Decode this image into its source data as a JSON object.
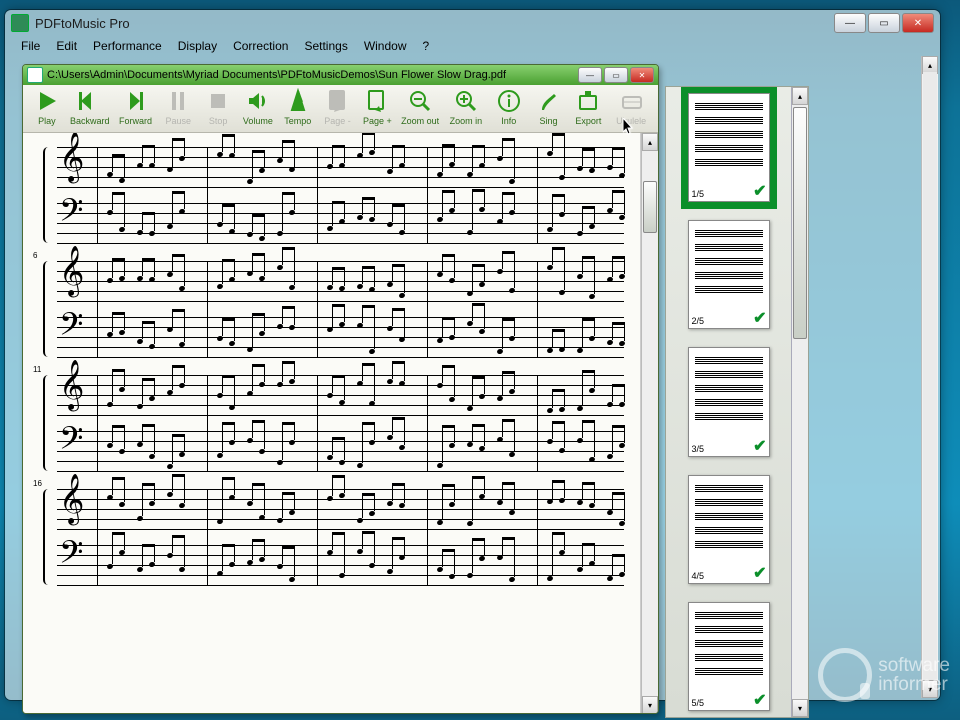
{
  "app": {
    "title": "PDFtoMusic Pro"
  },
  "menubar": [
    "File",
    "Edit",
    "Performance",
    "Display",
    "Correction",
    "Settings",
    "Window",
    "?"
  ],
  "doc": {
    "path": "C:\\Users\\Admin\\Documents\\Myriad Documents\\PDFtoMusicDemos\\Sun Flower Slow Drag.pdf"
  },
  "toolbar": [
    {
      "id": "play",
      "label": "Play",
      "enabled": true
    },
    {
      "id": "backward",
      "label": "Backward",
      "enabled": true
    },
    {
      "id": "forward",
      "label": "Forward",
      "enabled": true
    },
    {
      "id": "pause",
      "label": "Pause",
      "enabled": false
    },
    {
      "id": "stop",
      "label": "Stop",
      "enabled": false
    },
    {
      "id": "volume",
      "label": "Volume",
      "enabled": true
    },
    {
      "id": "tempo",
      "label": "Tempo",
      "enabled": true
    },
    {
      "id": "page-",
      "label": "Page -",
      "enabled": false
    },
    {
      "id": "page+",
      "label": "Page +",
      "enabled": true
    },
    {
      "id": "zoomout",
      "label": "Zoom out",
      "enabled": true
    },
    {
      "id": "zoomin",
      "label": "Zoom in",
      "enabled": true
    },
    {
      "id": "info",
      "label": "Info",
      "enabled": true
    },
    {
      "id": "sing",
      "label": "Sing",
      "enabled": true
    },
    {
      "id": "export",
      "label": "Export",
      "enabled": true
    },
    {
      "id": "ukulele",
      "label": "Ukulele",
      "enabled": false
    }
  ],
  "page_total": 5,
  "thumbs": [
    {
      "label": "1/5",
      "selected": true,
      "checked": true
    },
    {
      "label": "2/5",
      "selected": false,
      "checked": true
    },
    {
      "label": "3/5",
      "selected": false,
      "checked": true
    },
    {
      "label": "4/5",
      "selected": false,
      "checked": true
    },
    {
      "label": "5/5",
      "selected": false,
      "checked": true
    }
  ],
  "measure_numbers": [
    "",
    "6",
    "11",
    "16"
  ],
  "watermark": {
    "line1": "software",
    "line2": "informer"
  }
}
